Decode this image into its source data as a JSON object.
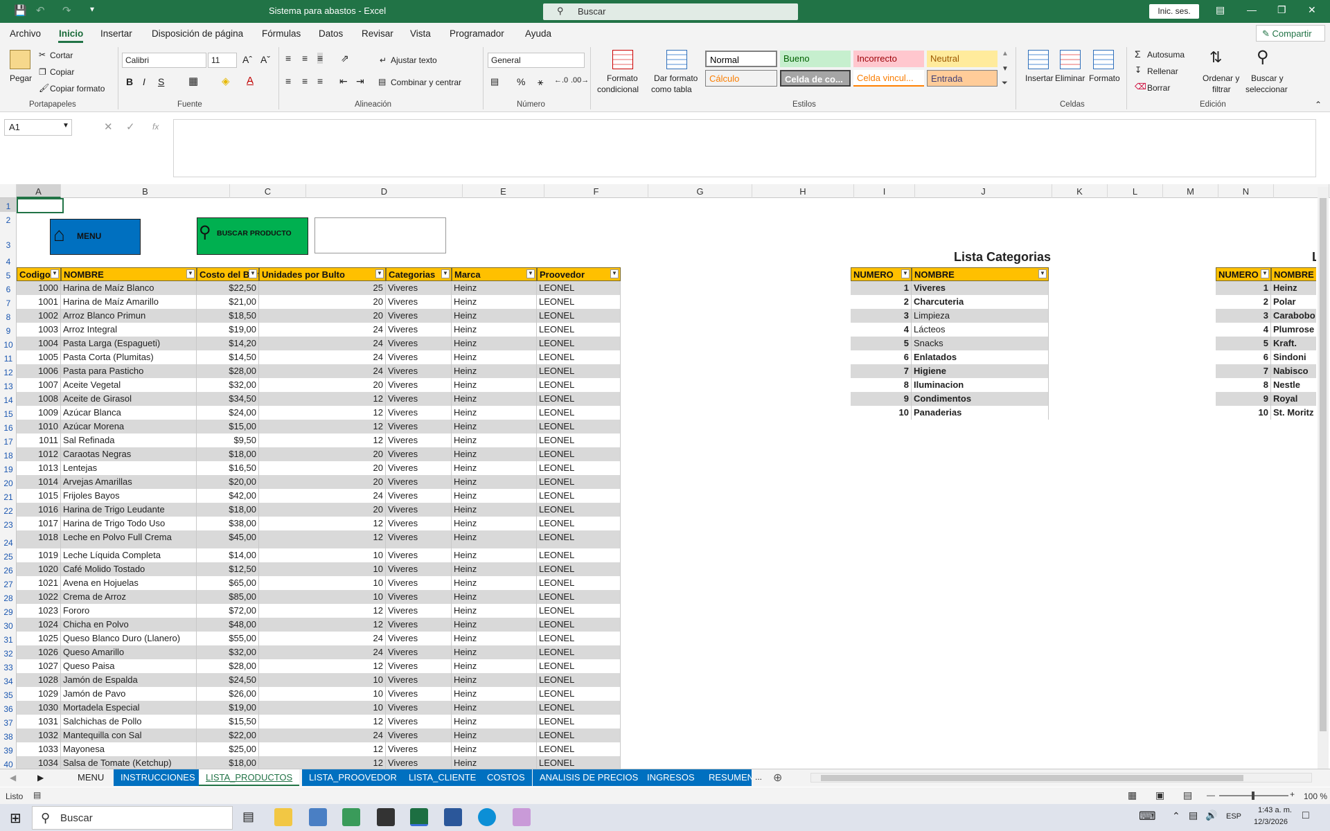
{
  "app": {
    "window_title": "Sistema para abastos  -  Excel",
    "search_placeholder": "Buscar",
    "sign_in": "Inic. ses.",
    "share": "Compartir"
  },
  "menu": [
    "Archivo",
    "Inicio",
    "Insertar",
    "Disposición de página",
    "Fórmulas",
    "Datos",
    "Revisar",
    "Vista",
    "Programador",
    "Ayuda"
  ],
  "ribbon": {
    "clipboard": {
      "paste": "Pegar",
      "cut": "Cortar",
      "copy": "Copiar",
      "format_painter": "Copiar formato",
      "group": "Portapapeles"
    },
    "font": {
      "name": "Calibri",
      "size": "11",
      "group": "Fuente"
    },
    "alignment": {
      "wrap": "Ajustar texto",
      "merge": "Combinar y centrar",
      "group": "Alineación"
    },
    "number": {
      "format": "General",
      "group": "Número"
    },
    "styles": {
      "cond_format_1": "Formato",
      "cond_format_2": "condicional",
      "table_format_1": "Dar formato",
      "table_format_2": "como tabla",
      "cells": [
        {
          "label": "Normal",
          "bg": "#ffffff",
          "fg": "#000000"
        },
        {
          "label": "Bueno",
          "bg": "#c6efce",
          "fg": "#006100"
        },
        {
          "label": "Incorrecto",
          "bg": "#ffc7ce",
          "fg": "#9c0006"
        },
        {
          "label": "Neutral",
          "bg": "#ffeb9c",
          "fg": "#9c5700"
        },
        {
          "label": "Cálculo",
          "bg": "#f2f2f2",
          "fg": "#fa7d00"
        },
        {
          "label": "Celda de co...",
          "bg": "#a5a5a5",
          "fg": "#ffffff"
        },
        {
          "label": "Celda vincul...",
          "bg": "#ffffff",
          "fg": "#fa7d00"
        },
        {
          "label": "Entrada",
          "bg": "#ffcc99",
          "fg": "#3f3f76"
        }
      ],
      "group": "Estilos"
    },
    "cells": {
      "insert": "Insertar",
      "delete": "Eliminar",
      "format": "Formato",
      "group": "Celdas"
    },
    "editing": {
      "autosum": "Autosuma",
      "fill": "Rellenar",
      "clear": "Borrar",
      "sort_1": "Ordenar y",
      "sort_2": "filtrar",
      "find_1": "Buscar y",
      "find_2": "seleccionar",
      "group": "Edición"
    }
  },
  "formula": {
    "namebox": "A1",
    "fx": "fx",
    "content": ""
  },
  "columns": [
    {
      "label": "A",
      "w": 64
    },
    {
      "label": "B",
      "w": 244
    },
    {
      "label": "C",
      "w": 110
    },
    {
      "label": "D",
      "w": 226
    },
    {
      "label": "E",
      "w": 118
    },
    {
      "label": "F",
      "w": 150
    },
    {
      "label": "G",
      "w": 150
    },
    {
      "label": "H",
      "w": 147
    },
    {
      "label": "I",
      "w": 88
    },
    {
      "label": "J",
      "w": 198
    },
    {
      "label": "K",
      "w": 80
    },
    {
      "label": "L",
      "w": 80
    },
    {
      "label": "M",
      "w": 80
    },
    {
      "label": "N",
      "w": 80
    },
    {
      "label": "",
      "w": 80
    }
  ],
  "row_numbers": [
    "1",
    "2",
    "3",
    "4",
    "5",
    "6",
    "7",
    "8",
    "9",
    "10",
    "11",
    "12",
    "13",
    "14",
    "15",
    "16",
    "17",
    "18",
    "19",
    "20",
    "21",
    "22",
    "23",
    "24",
    "25",
    "26",
    "27",
    "28",
    "29",
    "30",
    "31",
    "32",
    "33",
    "34",
    "35",
    "36",
    "37",
    "38",
    "39",
    "40"
  ],
  "buttons": {
    "menu": "MENU",
    "search": "BUSCAR PRODUCTO"
  },
  "products": {
    "headers": [
      "Codigo",
      "NOMBRE",
      "Costo del Bulto",
      "Unidades por Bulto",
      "Categorias",
      "Marca",
      "Proovedor"
    ],
    "rows": [
      [
        "1000",
        "Harina de Maíz Blanco",
        "$22,50",
        "25",
        "Viveres",
        "Heinz",
        "LEONEL"
      ],
      [
        "1001",
        "Harina de Maíz Amarillo",
        "$21,00",
        "20",
        "Viveres",
        "Heinz",
        "LEONEL"
      ],
      [
        "1002",
        "Arroz Blanco Primun",
        "$18,50",
        "20",
        "Viveres",
        "Heinz",
        "LEONEL"
      ],
      [
        "1003",
        "Arroz Integral",
        "$19,00",
        "24",
        "Viveres",
        "Heinz",
        "LEONEL"
      ],
      [
        "1004",
        "Pasta Larga (Espagueti)",
        "$14,20",
        "24",
        "Viveres",
        "Heinz",
        "LEONEL"
      ],
      [
        "1005",
        "Pasta Corta (Plumitas)",
        "$14,50",
        "24",
        "Viveres",
        "Heinz",
        "LEONEL"
      ],
      [
        "1006",
        "Pasta para Pasticho",
        "$28,00",
        "24",
        "Viveres",
        "Heinz",
        "LEONEL"
      ],
      [
        "1007",
        "Aceite Vegetal",
        "$32,00",
        "20",
        "Viveres",
        "Heinz",
        "LEONEL"
      ],
      [
        "1008",
        "Aceite de Girasol",
        "$34,50",
        "12",
        "Viveres",
        "Heinz",
        "LEONEL"
      ],
      [
        "1009",
        "Azúcar Blanca",
        "$24,00",
        "12",
        "Viveres",
        "Heinz",
        "LEONEL"
      ],
      [
        "1010",
        "Azúcar Morena",
        "$15,00",
        "12",
        "Viveres",
        "Heinz",
        "LEONEL"
      ],
      [
        "1011",
        "Sal Refinada",
        "$9,50",
        "12",
        "Viveres",
        "Heinz",
        "LEONEL"
      ],
      [
        "1012",
        "Caraotas Negras",
        "$18,00",
        "20",
        "Viveres",
        "Heinz",
        "LEONEL"
      ],
      [
        "1013",
        "Lentejas",
        "$16,50",
        "20",
        "Viveres",
        "Heinz",
        "LEONEL"
      ],
      [
        "1014",
        "Arvejas Amarillas",
        "$20,00",
        "20",
        "Viveres",
        "Heinz",
        "LEONEL"
      ],
      [
        "1015",
        "Frijoles Bayos",
        "$42,00",
        "24",
        "Viveres",
        "Heinz",
        "LEONEL"
      ],
      [
        "1016",
        "Harina de Trigo Leudante",
        "$18,00",
        "20",
        "Viveres",
        "Heinz",
        "LEONEL"
      ],
      [
        "1017",
        "Harina de Trigo Todo Uso",
        "$38,00",
        "12",
        "Viveres",
        "Heinz",
        "LEONEL"
      ],
      [
        "1018",
        "Leche en Polvo Full Crema",
        "$45,00",
        "12",
        "Viveres",
        "Heinz",
        "LEONEL"
      ],
      [
        "1019",
        "Leche Líquida Completa",
        "$14,00",
        "10",
        "Viveres",
        "Heinz",
        "LEONEL"
      ],
      [
        "1020",
        "Café Molido Tostado",
        "$12,50",
        "10",
        "Viveres",
        "Heinz",
        "LEONEL"
      ],
      [
        "1021",
        "Avena en Hojuelas",
        "$65,00",
        "10",
        "Viveres",
        "Heinz",
        "LEONEL"
      ],
      [
        "1022",
        "Crema de Arroz",
        "$85,00",
        "10",
        "Viveres",
        "Heinz",
        "LEONEL"
      ],
      [
        "1023",
        "Fororo",
        "$72,00",
        "12",
        "Viveres",
        "Heinz",
        "LEONEL"
      ],
      [
        "1024",
        "Chicha en Polvo",
        "$48,00",
        "12",
        "Viveres",
        "Heinz",
        "LEONEL"
      ],
      [
        "1025",
        "Queso Blanco Duro (Llanero)",
        "$55,00",
        "24",
        "Viveres",
        "Heinz",
        "LEONEL"
      ],
      [
        "1026",
        "Queso Amarillo",
        "$32,00",
        "24",
        "Viveres",
        "Heinz",
        "LEONEL"
      ],
      [
        "1027",
        "Queso Paisa",
        "$28,00",
        "12",
        "Viveres",
        "Heinz",
        "LEONEL"
      ],
      [
        "1028",
        "Jamón de Espalda",
        "$24,50",
        "10",
        "Viveres",
        "Heinz",
        "LEONEL"
      ],
      [
        "1029",
        "Jamón de Pavo",
        "$26,00",
        "10",
        "Viveres",
        "Heinz",
        "LEONEL"
      ],
      [
        "1030",
        "Mortadela Especial",
        "$19,00",
        "10",
        "Viveres",
        "Heinz",
        "LEONEL"
      ],
      [
        "1031",
        "Salchichas de Pollo",
        "$15,50",
        "12",
        "Viveres",
        "Heinz",
        "LEONEL"
      ],
      [
        "1032",
        "Mantequilla con Sal",
        "$22,00",
        "24",
        "Viveres",
        "Heinz",
        "LEONEL"
      ],
      [
        "1033",
        "Mayonesa",
        "$25,00",
        "12",
        "Viveres",
        "Heinz",
        "LEONEL"
      ],
      [
        "1034",
        "Salsa de Tomate (Ketchup)",
        "$18,00",
        "12",
        "Viveres",
        "Heinz",
        "LEONEL"
      ]
    ]
  },
  "categories": {
    "title": "Lista Categorias",
    "headers": [
      "NUMERO",
      "NOMBRE"
    ],
    "rows": [
      [
        "1",
        "Viveres"
      ],
      [
        "2",
        "Charcuteria"
      ],
      [
        "3",
        "Limpieza"
      ],
      [
        "4",
        "Lácteos"
      ],
      [
        "5",
        "Snacks"
      ],
      [
        "6",
        "Enlatados"
      ],
      [
        "7",
        "Higiene"
      ],
      [
        "8",
        "Iluminacion"
      ],
      [
        "9",
        "Condimentos"
      ],
      [
        "10",
        "Panaderias"
      ]
    ]
  },
  "brands": {
    "title": "L",
    "headers": [
      "NUMERO",
      "NOMBRE"
    ],
    "rows": [
      [
        "1",
        "Heinz"
      ],
      [
        "2",
        "Polar"
      ],
      [
        "3",
        "Carabobo"
      ],
      [
        "4",
        "Plumrose"
      ],
      [
        "5",
        "Kraft."
      ],
      [
        "6",
        "Sindoni"
      ],
      [
        "7",
        "Nabisco"
      ],
      [
        "8",
        "Nestle"
      ],
      [
        "9",
        "Royal"
      ],
      [
        "10",
        "St. Moritz"
      ]
    ]
  },
  "sheets": [
    "MENU",
    "INSTRUCCIONES",
    "LISTA_PRODUCTOS",
    "LISTA_PROOVEDOR",
    "LISTA_CLIENTE",
    "COSTOS",
    "ANALISIS DE PRECIOS",
    "INGRESOS",
    "RESUMEN"
  ],
  "active_sheet": "LISTA_PRODUCTOS",
  "status": {
    "ready": "Listo",
    "zoom": "100 %"
  },
  "taskbar": {
    "search": "Buscar",
    "time": "1:43 a. m.",
    "date": "12/3/2026",
    "lang": "ESP"
  }
}
